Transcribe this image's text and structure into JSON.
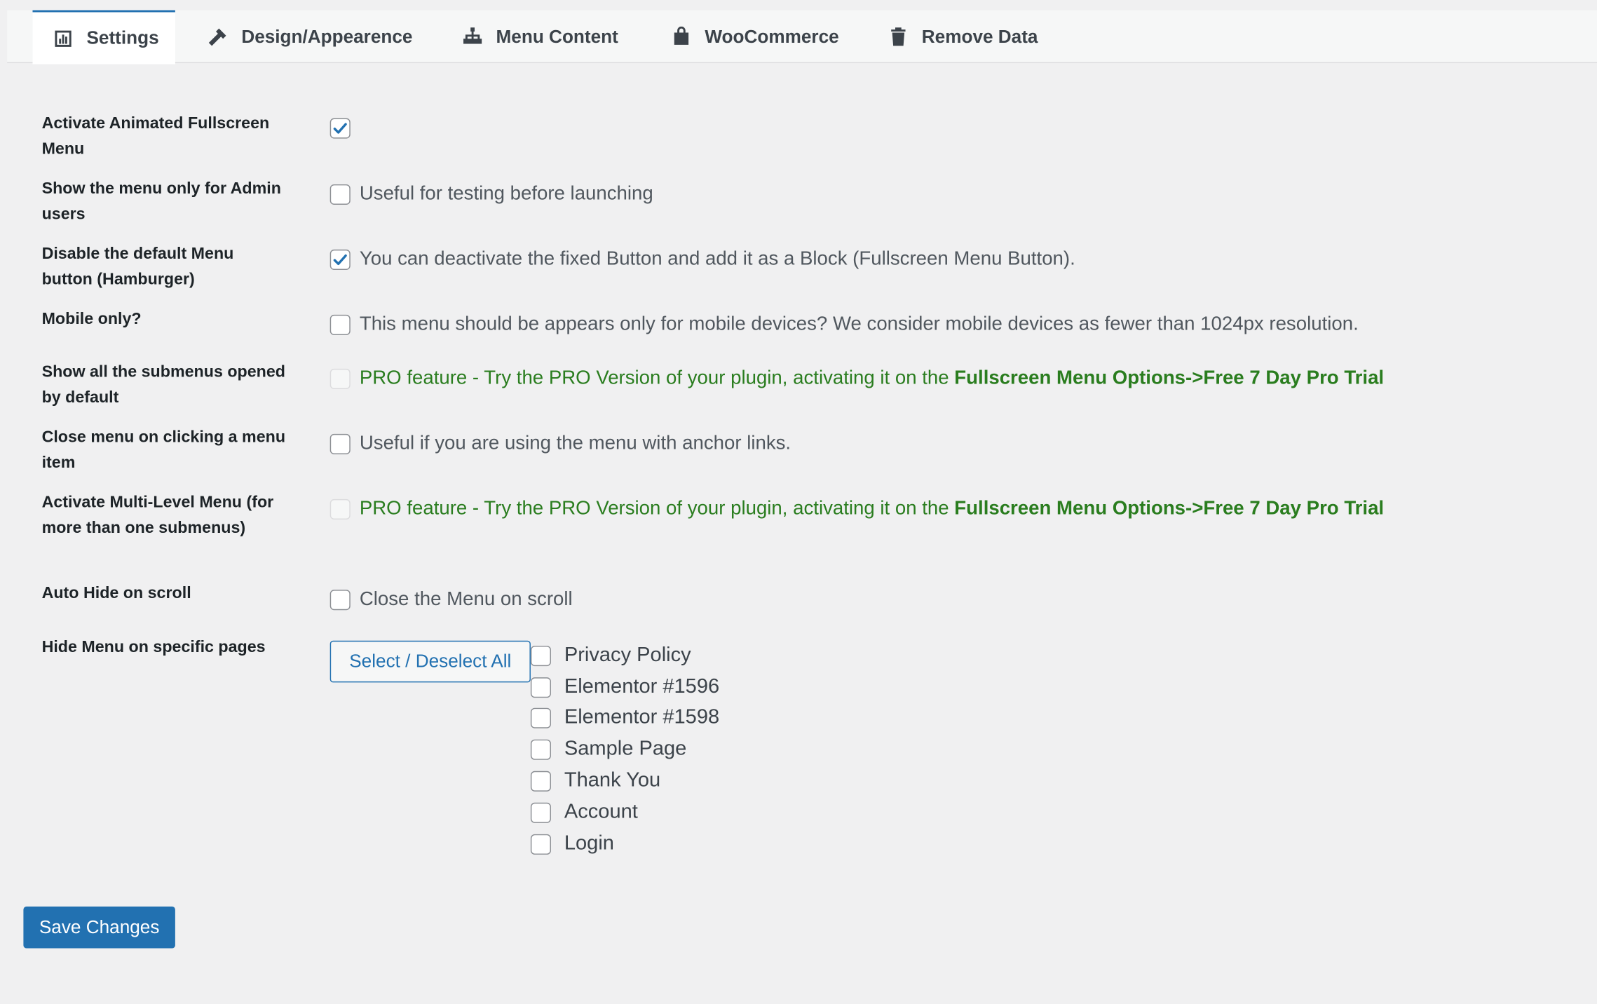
{
  "tabs": [
    {
      "label": "Settings",
      "icon": "chart-icon",
      "active": true
    },
    {
      "label": "Design/Appearence",
      "icon": "hammer-icon",
      "active": false
    },
    {
      "label": "Menu Content",
      "icon": "sitemap-icon",
      "active": false
    },
    {
      "label": "WooCommerce",
      "icon": "shopping-bag-icon",
      "active": false
    },
    {
      "label": "Remove Data",
      "icon": "trash-icon",
      "active": false
    }
  ],
  "settings": {
    "activate": {
      "label": "Activate Animated Fullscreen Menu",
      "checked": true,
      "desc": ""
    },
    "admin_only": {
      "label": "Show the menu only for Admin users",
      "checked": false,
      "desc": "Useful for testing before launching"
    },
    "disable_default": {
      "label": "Disable the default Menu button (Hamburger)",
      "checked": true,
      "desc": "You can deactivate the fixed Button and add it as a Block (Fullscreen Menu Button)."
    },
    "mobile_only": {
      "label": "Mobile only?",
      "checked": false,
      "desc": "This menu should be appears only for mobile devices? We consider mobile devices as fewer than 1024px resolution."
    },
    "submenus_open": {
      "label": "Show all the submenus opened by default",
      "checked": false,
      "disabled": true,
      "pro_text": "PRO feature - Try the PRO Version of your plugin, activating it on the ",
      "pro_link": "Fullscreen Menu Options->Free 7 Day Pro Trial"
    },
    "close_on_click": {
      "label": "Close menu on clicking a menu item",
      "checked": false,
      "desc": "Useful if you are using the menu with anchor links."
    },
    "multi_level": {
      "label": "Activate Multi-Level Menu (for more than one submenus)",
      "checked": false,
      "disabled": true,
      "pro_text": "PRO feature - Try the PRO Version of your plugin, activating it on the ",
      "pro_link": "Fullscreen Menu Options->Free 7 Day Pro Trial"
    },
    "auto_hide": {
      "label": "Auto Hide on scroll",
      "checked": false,
      "desc": "Close the Menu on scroll"
    },
    "hide_pages": {
      "label": "Hide Menu on specific pages",
      "select_all_label": "Select / Deselect All",
      "pages": [
        {
          "title": "Privacy Policy",
          "checked": false
        },
        {
          "title": "Elementor #1596",
          "checked": false
        },
        {
          "title": "Elementor #1598",
          "checked": false
        },
        {
          "title": "Sample Page",
          "checked": false
        },
        {
          "title": "Thank You",
          "checked": false
        },
        {
          "title": "Account",
          "checked": false
        },
        {
          "title": "Login",
          "checked": false
        }
      ]
    }
  },
  "save_label": "Save Changes",
  "colors": {
    "accent": "#2271b1",
    "pro_green": "#2a7d1f",
    "background": "#f0f0f1"
  }
}
